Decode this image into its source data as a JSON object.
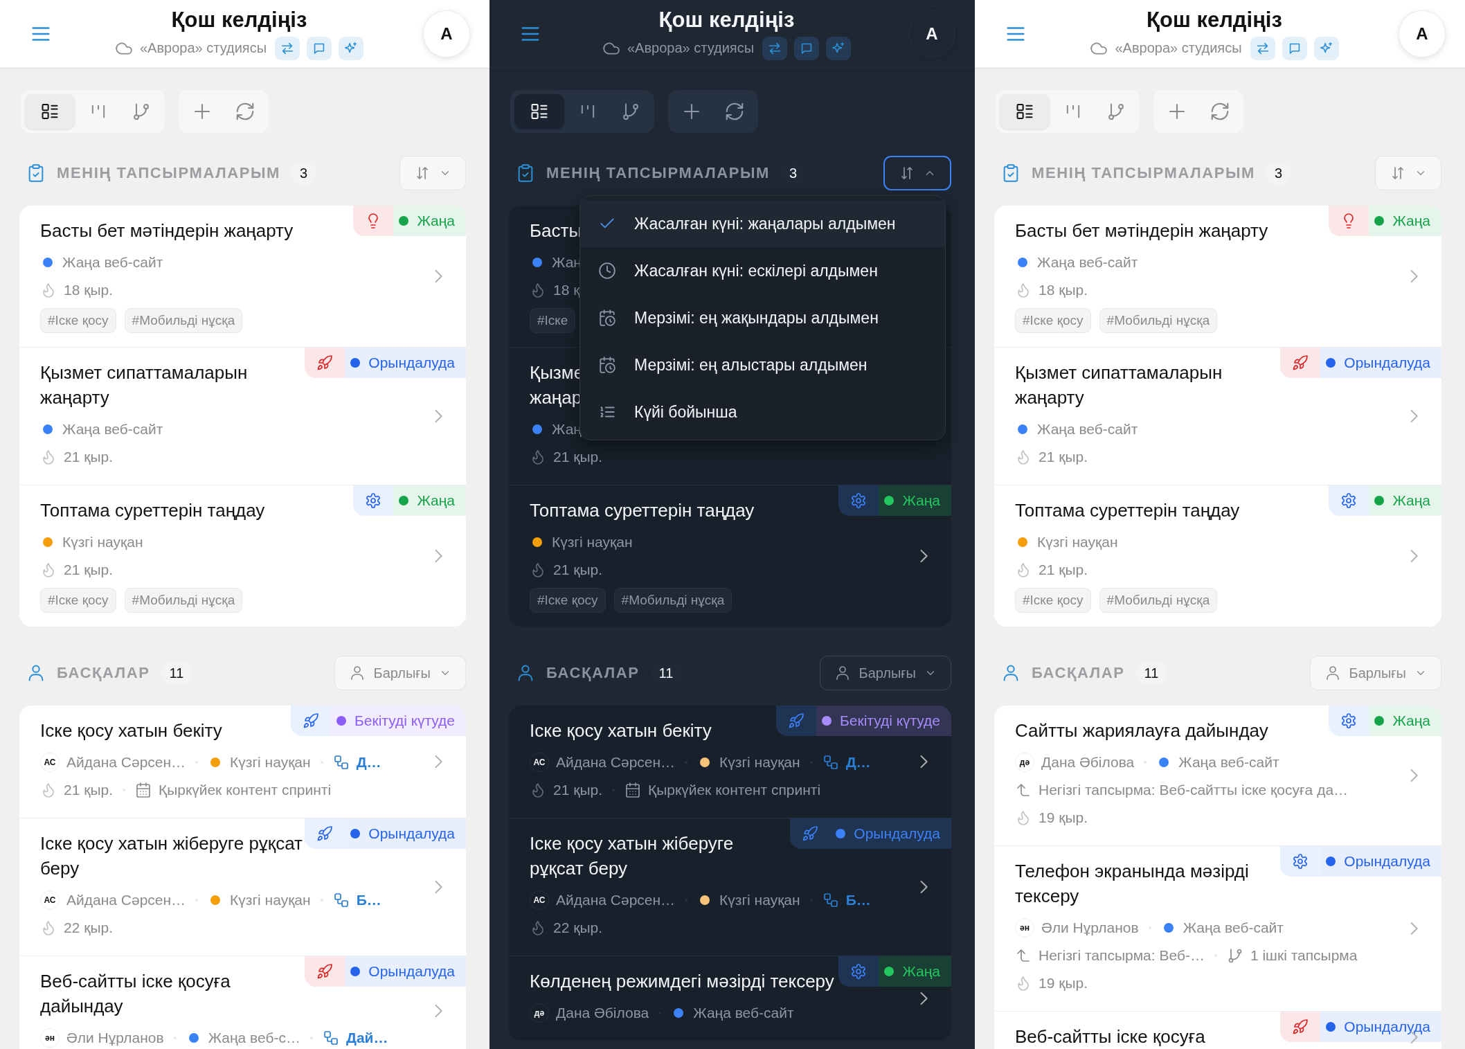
{
  "screens": [
    {
      "dark": false,
      "header": {
        "title": "Қош келдіңіз",
        "subtitle": "«Аврора» студиясы",
        "avatar": "A"
      },
      "views": [
        {
          "kind": "list",
          "selected": true
        },
        {
          "kind": "board",
          "selected": false
        },
        {
          "kind": "tree",
          "selected": false
        }
      ],
      "sections": [
        {
          "kind": "mine",
          "title": "МЕНІҢ ТАПСЫРМАЛАРЫМ",
          "count": "3",
          "control": {
            "kind": "sort",
            "open": false
          },
          "cards": [
            {
              "title": "Басты бет мәтіндерін жаңарту",
              "badge": {
                "kind": "bulb",
                "urgent": true,
                "status": "Жаңа",
                "color": "#16a34a"
              },
              "rows": [
                [
                  {
                    "kind": "project",
                    "text": "Жаңа веб-сайт",
                    "color": "#3b82f6"
                  }
                ],
                [
                  {
                    "kind": "age",
                    "text": "18 қыр."
                  }
                ]
              ],
              "tags": [
                "#Іске қосу",
                "#Мобильді нұсқа"
              ]
            },
            {
              "title": "Қызмет сипаттамаларын жаңарту",
              "badge": {
                "kind": "rocket",
                "urgent": true,
                "status": "Орындалуда",
                "color": "#2563eb"
              },
              "rows": [
                [
                  {
                    "kind": "project",
                    "text": "Жаңа веб-сайт",
                    "color": "#3b82f6"
                  }
                ],
                [
                  {
                    "kind": "age",
                    "text": "21 қыр."
                  }
                ]
              ]
            },
            {
              "title": "Топтама суреттерін таңдау",
              "badge": {
                "kind": "gear",
                "urgent": false,
                "status": "Жаңа",
                "color": "#16a34a"
              },
              "rows": [
                [
                  {
                    "kind": "project",
                    "text": "Күзгі науқан",
                    "color": "#f59e0b"
                  }
                ],
                [
                  {
                    "kind": "age",
                    "text": "21 қыр."
                  }
                ]
              ],
              "tags": [
                "#Іске қосу",
                "#Мобильді нұсқа"
              ]
            }
          ]
        },
        {
          "kind": "others",
          "title": "БАСҚАЛАР",
          "count": "11",
          "control": {
            "kind": "filter",
            "label": "Барлығы"
          },
          "cards": [
            {
              "title": "Іске қосу хатын бекіту",
              "badge": {
                "kind": "rocket",
                "urgent": false,
                "status": "Бекітуді күтуде",
                "color": "#8b5cf6"
              },
              "rows": [
                [
                  {
                    "kind": "assignee",
                    "initials": "АС",
                    "text": "Айдана Сәрсен…"
                  },
                  {
                    "kind": "project",
                    "text": "Күзгі науқан",
                    "color": "#f59e0b"
                  },
                  {
                    "kind": "dependency",
                    "text": "Д…"
                  }
                ],
                [
                  {
                    "kind": "age",
                    "text": "21 қыр."
                  },
                  {
                    "kind": "sprint",
                    "text": "Қыркүйек контент спринті"
                  }
                ]
              ]
            },
            {
              "title": "Іске қосу хатын жіберуге рұқсат беру",
              "badge": {
                "kind": "rocket",
                "urgent": false,
                "status": "Орындалуда",
                "color": "#2563eb"
              },
              "rows": [
                [
                  {
                    "kind": "assignee",
                    "initials": "АС",
                    "text": "Айдана Сәрсен…"
                  },
                  {
                    "kind": "project",
                    "text": "Күзгі науқан",
                    "color": "#f59e0b"
                  },
                  {
                    "kind": "dependency",
                    "text": "Б…"
                  }
                ],
                [
                  {
                    "kind": "age",
                    "text": "22 қыр."
                  }
                ]
              ]
            },
            {
              "title": "Веб-сайтты іске қосуға дайындау",
              "badge": {
                "kind": "rocket",
                "urgent": true,
                "status": "Орындалуда",
                "color": "#2563eb"
              },
              "rows": [
                [
                  {
                    "kind": "assignee",
                    "initials": "ән",
                    "text": "Әли Нұрланов"
                  },
                  {
                    "kind": "project",
                    "text": "Жаңа веб-с…",
                    "color": "#3b82f6"
                  },
                  {
                    "kind": "dependency",
                    "text": "Дай…"
                  }
                ]
              ]
            }
          ]
        }
      ]
    },
    {
      "dark": true,
      "header": {
        "title": "Қош келдіңіз",
        "subtitle": "«Аврора» студиясы",
        "avatar": "A"
      },
      "views": [
        {
          "kind": "list",
          "selected": true
        },
        {
          "kind": "board",
          "selected": false
        },
        {
          "kind": "tree",
          "selected": false
        }
      ],
      "sections": [
        {
          "kind": "mine",
          "title": "МЕНІҢ ТАПСЫРМАЛАРЫМ",
          "count": "3",
          "control": {
            "kind": "sort",
            "open": true,
            "options": [
              {
                "label": "Жасалған күні: жаңалары алдымен",
                "selected": true
              },
              {
                "label": "Жасалған күні: ескілері алдымен",
                "kind": "clock",
                "selected": false
              },
              {
                "label": "Мерзімі: ең жақындары алдымен",
                "kind": "calendar",
                "selected": false
              },
              {
                "label": "Мерзімі: ең алыстары алдымен",
                "kind": "calendar",
                "selected": false
              },
              {
                "label": "Күйі бойынша",
                "kind": "list",
                "selected": false
              }
            ]
          },
          "cards": [
            {
              "title": "Басты",
              "rows": [
                [
                  {
                    "kind": "project",
                    "text": "Жаң",
                    "color": "#3b82f6"
                  }
                ],
                [
                  {
                    "kind": "age",
                    "text": "18 қ"
                  }
                ]
              ],
              "tags": [
                "#Іске"
              ]
            },
            {
              "title": "Қызме\nжаңар",
              "rows": [
                [
                  {
                    "kind": "project",
                    "text": "Жаң",
                    "color": "#3b82f6"
                  }
                ],
                [
                  {
                    "kind": "age",
                    "text": "21 қыр."
                  }
                ]
              ]
            },
            {
              "title": "Топтама суреттерін таңдау",
              "badge": {
                "kind": "gear",
                "urgent": false,
                "status": "Жаңа",
                "color": "#22c55e"
              },
              "rows": [
                [
                  {
                    "kind": "project",
                    "text": "Күзгі науқан",
                    "color": "#f59e0b"
                  }
                ],
                [
                  {
                    "kind": "age",
                    "text": "21 қыр."
                  }
                ]
              ],
              "tags": [
                "#Іске қосу",
                "#Мобильді нұсқа"
              ]
            }
          ]
        },
        {
          "kind": "others",
          "title": "БАСҚАЛАР",
          "count": "11",
          "control": {
            "kind": "filter",
            "label": "Барлығы"
          },
          "cards": [
            {
              "title": "Іске қосу хатын бекіту",
              "badge": {
                "kind": "rocket",
                "urgent": false,
                "status": "Бекітуді күтуде",
                "color": "#a78bfa"
              },
              "rows": [
                [
                  {
                    "kind": "assignee",
                    "initials": "АС",
                    "text": "Айдана Сәрсен…"
                  },
                  {
                    "kind": "project",
                    "text": "Күзгі науқан",
                    "color": "#f5c47a"
                  },
                  {
                    "kind": "dependency",
                    "text": "Д…"
                  }
                ],
                [
                  {
                    "kind": "age",
                    "text": "21 қыр."
                  },
                  {
                    "kind": "sprint",
                    "text": "Қыркүйек контент спринті"
                  }
                ]
              ]
            },
            {
              "title": "Іске қосу хатын жіберуге рұқсат беру",
              "badge": {
                "kind": "rocket",
                "urgent": false,
                "status": "Орындалуда",
                "color": "#3b82f6"
              },
              "rows": [
                [
                  {
                    "kind": "assignee",
                    "initials": "АС",
                    "text": "Айдана Сәрсен…"
                  },
                  {
                    "kind": "project",
                    "text": "Күзгі науқан",
                    "color": "#f5c47a"
                  },
                  {
                    "kind": "dependency",
                    "text": "Б…"
                  }
                ],
                [
                  {
                    "kind": "age",
                    "text": "22 қыр."
                  }
                ]
              ]
            },
            {
              "title": "Көлденең режимдегі мәзірді тексеру",
              "badge": {
                "kind": "gear",
                "urgent": false,
                "status": "Жаңа",
                "color": "#22c55e"
              },
              "rows": [
                [
                  {
                    "kind": "assignee",
                    "initials": "дә",
                    "text": "Дана Әбілова"
                  },
                  {
                    "kind": "project",
                    "text": "Жаңа веб-сайт",
                    "color": "#3b82f6"
                  }
                ]
              ]
            }
          ]
        }
      ]
    },
    {
      "dark": false,
      "header": {
        "title": "Қош келдіңіз",
        "subtitle": "«Аврора» студиясы",
        "avatar": "A"
      },
      "views": [
        {
          "kind": "list",
          "selected": true
        },
        {
          "kind": "board",
          "selected": false
        },
        {
          "kind": "tree",
          "selected": false
        }
      ],
      "sections": [
        {
          "kind": "mine",
          "title": "МЕНІҢ ТАПСЫРМАЛАРЫМ",
          "count": "3",
          "control": {
            "kind": "sort",
            "open": false
          },
          "cards": [
            {
              "title": "Басты бет мәтіндерін жаңарту",
              "badge": {
                "kind": "bulb",
                "urgent": true,
                "status": "Жаңа",
                "color": "#16a34a"
              },
              "rows": [
                [
                  {
                    "kind": "project",
                    "text": "Жаңа веб-сайт",
                    "color": "#3b82f6"
                  }
                ],
                [
                  {
                    "kind": "age",
                    "text": "18 қыр."
                  }
                ]
              ],
              "tags": [
                "#Іске қосу",
                "#Мобильді нұсқа"
              ]
            },
            {
              "title": "Қызмет сипаттамаларын жаңарту",
              "badge": {
                "kind": "rocket",
                "urgent": true,
                "status": "Орындалуда",
                "color": "#2563eb"
              },
              "rows": [
                [
                  {
                    "kind": "project",
                    "text": "Жаңа веб-сайт",
                    "color": "#3b82f6"
                  }
                ],
                [
                  {
                    "kind": "age",
                    "text": "21 қыр."
                  }
                ]
              ]
            },
            {
              "title": "Топтама суреттерін таңдау",
              "badge": {
                "kind": "gear",
                "urgent": false,
                "status": "Жаңа",
                "color": "#16a34a"
              },
              "rows": [
                [
                  {
                    "kind": "project",
                    "text": "Күзгі науқан",
                    "color": "#f59e0b"
                  }
                ],
                [
                  {
                    "kind": "age",
                    "text": "21 қыр."
                  }
                ]
              ],
              "tags": [
                "#Іске қосу",
                "#Мобильді нұсқа"
              ]
            }
          ]
        },
        {
          "kind": "others",
          "title": "БАСҚАЛАР",
          "count": "11",
          "control": {
            "kind": "filter",
            "label": "Барлығы"
          },
          "cards": [
            {
              "title": "Сайтты жариялауға дайындау",
              "badge": {
                "kind": "gear",
                "urgent": false,
                "status": "Жаңа",
                "color": "#16a34a"
              },
              "rows": [
                [
                  {
                    "kind": "assignee",
                    "initials": "дә",
                    "text": "Дана Әбілова"
                  },
                  {
                    "kind": "project",
                    "text": "Жаңа веб-сайт",
                    "color": "#3b82f6"
                  }
                ],
                [
                  {
                    "kind": "parent",
                    "text": "Негізгі тапсырма: Веб-сайтты іске қосуға да…"
                  }
                ],
                [
                  {
                    "kind": "age",
                    "text": "19 қыр."
                  }
                ]
              ]
            },
            {
              "title": "Телефон экранында мәзірді тексеру",
              "badge": {
                "kind": "gear",
                "urgent": false,
                "status": "Орындалуда",
                "color": "#2563eb"
              },
              "rows": [
                [
                  {
                    "kind": "assignee",
                    "initials": "ән",
                    "text": "Әли Нұрланов"
                  },
                  {
                    "kind": "project",
                    "text": "Жаңа веб-сайт",
                    "color": "#3b82f6"
                  }
                ],
                [
                  {
                    "kind": "parent",
                    "text": "Негізгі тапсырма: Веб-…"
                  },
                  {
                    "kind": "subtasks",
                    "text": "1 ішкі тапсырма"
                  }
                ],
                [
                  {
                    "kind": "age",
                    "text": "19 қыр."
                  }
                ]
              ]
            },
            {
              "title": "Веб-сайтты іске қосуға",
              "badge": {
                "kind": "rocket",
                "urgent": true,
                "status": "Орындалуда",
                "color": "#2563eb"
              }
            }
          ]
        }
      ]
    }
  ]
}
